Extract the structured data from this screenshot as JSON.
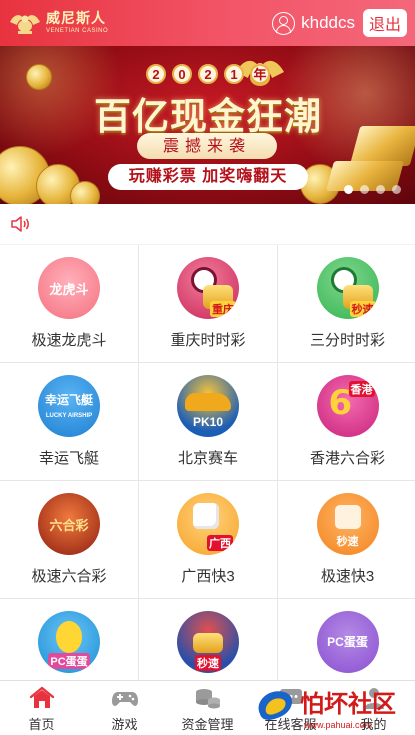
{
  "header": {
    "logo_cn": "威尼斯人",
    "logo_en": "VENETIAN CASINO",
    "username": "khddcs",
    "logout_label": "退出",
    "background_color": "#e8333f"
  },
  "banner": {
    "year_chars": [
      "2",
      "0",
      "2",
      "1",
      "年"
    ],
    "title": "百亿现金狂潮",
    "subtitle": "震撼来袭",
    "slogan": "玩赚彩票 加奖嗨翻天",
    "dot_count": 4,
    "active_dot": 0
  },
  "notice": {
    "icon": "speaker-icon"
  },
  "games": [
    {
      "label": "极速龙虎斗",
      "icon": "dragon-tiger-icon",
      "badge": "龙虎斗",
      "color": "#f5707f"
    },
    {
      "label": "重庆时时彩",
      "icon": "chongqing-clock-icon",
      "badge": "重庆",
      "color": "#c9265a"
    },
    {
      "label": "三分时时彩",
      "icon": "three-minute-clock-icon",
      "badge": "秒速",
      "color": "#34b44f"
    },
    {
      "label": "幸运飞艇",
      "icon": "lucky-airship-icon",
      "badge": "幸运飞艇",
      "badge2": "LUCKY AIRSHIP",
      "color": "#1f7fd3"
    },
    {
      "label": "北京赛车",
      "icon": "beijing-racing-icon",
      "badge": "PK10",
      "color": "#1c5eb6"
    },
    {
      "label": "香港六合彩",
      "icon": "hongkong-mark-six-icon",
      "badge": "香港",
      "color": "#c9237b"
    },
    {
      "label": "极速六合彩",
      "icon": "speed-mark-six-icon",
      "badge": "六合彩",
      "color": "#c9361d"
    },
    {
      "label": "广西快3",
      "icon": "guangxi-dice-icon",
      "badge": "广西",
      "color": "#f7a22a"
    },
    {
      "label": "极速快3",
      "icon": "speed-fast3-icon",
      "badge": "秒速",
      "color": "#f28420"
    },
    {
      "label": "",
      "icon": "pc-egg-icon",
      "badge": "PC蛋蛋",
      "color": "#1a8fd6"
    },
    {
      "label": "",
      "icon": "speed-racing-icon",
      "badge": "秒速",
      "color": "#2a4fa8"
    },
    {
      "label": "",
      "icon": "pc-egg-purple-icon",
      "badge": "PC蛋蛋",
      "color": "#8a4fd0"
    }
  ],
  "bottom_nav": [
    {
      "label": "首页",
      "icon": "home-icon",
      "active": true
    },
    {
      "label": "游戏",
      "icon": "gamepad-icon",
      "active": false
    },
    {
      "label": "资金管理",
      "icon": "coins-icon",
      "active": false
    },
    {
      "label": "在线客服",
      "icon": "chat-icon",
      "active": false
    },
    {
      "label": "我的",
      "icon": "profile-icon",
      "active": false
    }
  ],
  "watermark": {
    "text": "怕坏社区",
    "url_text": "www.pahuai.com"
  },
  "colors": {
    "accent": "#e8333f",
    "grid_line": "#e6e6e6",
    "text": "#333333"
  }
}
